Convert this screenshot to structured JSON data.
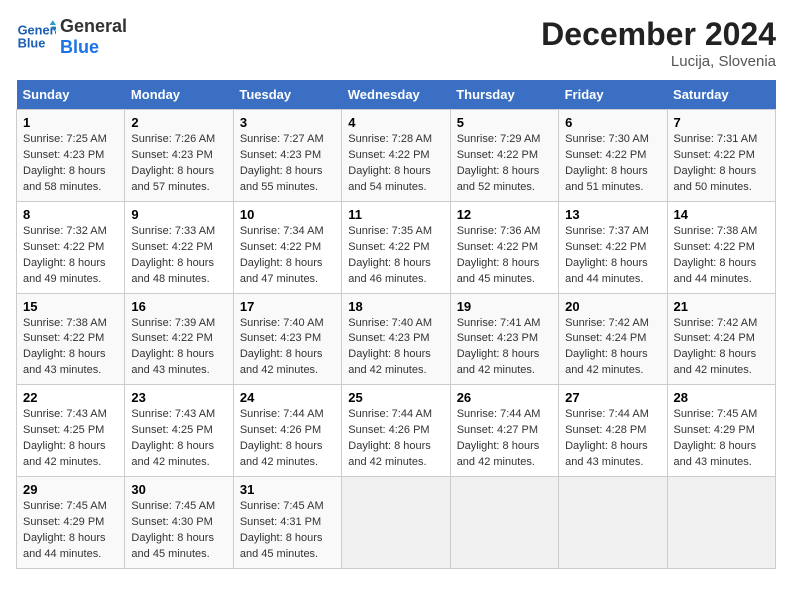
{
  "header": {
    "logo_line1": "General",
    "logo_line2": "Blue",
    "month_title": "December 2024",
    "location": "Lucija, Slovenia"
  },
  "weekdays": [
    "Sunday",
    "Monday",
    "Tuesday",
    "Wednesday",
    "Thursday",
    "Friday",
    "Saturday"
  ],
  "weeks": [
    [
      {
        "day": "1",
        "info": "Sunrise: 7:25 AM\nSunset: 4:23 PM\nDaylight: 8 hours and 58 minutes."
      },
      {
        "day": "2",
        "info": "Sunrise: 7:26 AM\nSunset: 4:23 PM\nDaylight: 8 hours and 57 minutes."
      },
      {
        "day": "3",
        "info": "Sunrise: 7:27 AM\nSunset: 4:23 PM\nDaylight: 8 hours and 55 minutes."
      },
      {
        "day": "4",
        "info": "Sunrise: 7:28 AM\nSunset: 4:22 PM\nDaylight: 8 hours and 54 minutes."
      },
      {
        "day": "5",
        "info": "Sunrise: 7:29 AM\nSunset: 4:22 PM\nDaylight: 8 hours and 52 minutes."
      },
      {
        "day": "6",
        "info": "Sunrise: 7:30 AM\nSunset: 4:22 PM\nDaylight: 8 hours and 51 minutes."
      },
      {
        "day": "7",
        "info": "Sunrise: 7:31 AM\nSunset: 4:22 PM\nDaylight: 8 hours and 50 minutes."
      }
    ],
    [
      {
        "day": "8",
        "info": "Sunrise: 7:32 AM\nSunset: 4:22 PM\nDaylight: 8 hours and 49 minutes."
      },
      {
        "day": "9",
        "info": "Sunrise: 7:33 AM\nSunset: 4:22 PM\nDaylight: 8 hours and 48 minutes."
      },
      {
        "day": "10",
        "info": "Sunrise: 7:34 AM\nSunset: 4:22 PM\nDaylight: 8 hours and 47 minutes."
      },
      {
        "day": "11",
        "info": "Sunrise: 7:35 AM\nSunset: 4:22 PM\nDaylight: 8 hours and 46 minutes."
      },
      {
        "day": "12",
        "info": "Sunrise: 7:36 AM\nSunset: 4:22 PM\nDaylight: 8 hours and 45 minutes."
      },
      {
        "day": "13",
        "info": "Sunrise: 7:37 AM\nSunset: 4:22 PM\nDaylight: 8 hours and 44 minutes."
      },
      {
        "day": "14",
        "info": "Sunrise: 7:38 AM\nSunset: 4:22 PM\nDaylight: 8 hours and 44 minutes."
      }
    ],
    [
      {
        "day": "15",
        "info": "Sunrise: 7:38 AM\nSunset: 4:22 PM\nDaylight: 8 hours and 43 minutes."
      },
      {
        "day": "16",
        "info": "Sunrise: 7:39 AM\nSunset: 4:22 PM\nDaylight: 8 hours and 43 minutes."
      },
      {
        "day": "17",
        "info": "Sunrise: 7:40 AM\nSunset: 4:23 PM\nDaylight: 8 hours and 42 minutes."
      },
      {
        "day": "18",
        "info": "Sunrise: 7:40 AM\nSunset: 4:23 PM\nDaylight: 8 hours and 42 minutes."
      },
      {
        "day": "19",
        "info": "Sunrise: 7:41 AM\nSunset: 4:23 PM\nDaylight: 8 hours and 42 minutes."
      },
      {
        "day": "20",
        "info": "Sunrise: 7:42 AM\nSunset: 4:24 PM\nDaylight: 8 hours and 42 minutes."
      },
      {
        "day": "21",
        "info": "Sunrise: 7:42 AM\nSunset: 4:24 PM\nDaylight: 8 hours and 42 minutes."
      }
    ],
    [
      {
        "day": "22",
        "info": "Sunrise: 7:43 AM\nSunset: 4:25 PM\nDaylight: 8 hours and 42 minutes."
      },
      {
        "day": "23",
        "info": "Sunrise: 7:43 AM\nSunset: 4:25 PM\nDaylight: 8 hours and 42 minutes."
      },
      {
        "day": "24",
        "info": "Sunrise: 7:44 AM\nSunset: 4:26 PM\nDaylight: 8 hours and 42 minutes."
      },
      {
        "day": "25",
        "info": "Sunrise: 7:44 AM\nSunset: 4:26 PM\nDaylight: 8 hours and 42 minutes."
      },
      {
        "day": "26",
        "info": "Sunrise: 7:44 AM\nSunset: 4:27 PM\nDaylight: 8 hours and 42 minutes."
      },
      {
        "day": "27",
        "info": "Sunrise: 7:44 AM\nSunset: 4:28 PM\nDaylight: 8 hours and 43 minutes."
      },
      {
        "day": "28",
        "info": "Sunrise: 7:45 AM\nSunset: 4:29 PM\nDaylight: 8 hours and 43 minutes."
      }
    ],
    [
      {
        "day": "29",
        "info": "Sunrise: 7:45 AM\nSunset: 4:29 PM\nDaylight: 8 hours and 44 minutes."
      },
      {
        "day": "30",
        "info": "Sunrise: 7:45 AM\nSunset: 4:30 PM\nDaylight: 8 hours and 45 minutes."
      },
      {
        "day": "31",
        "info": "Sunrise: 7:45 AM\nSunset: 4:31 PM\nDaylight: 8 hours and 45 minutes."
      },
      null,
      null,
      null,
      null
    ]
  ]
}
